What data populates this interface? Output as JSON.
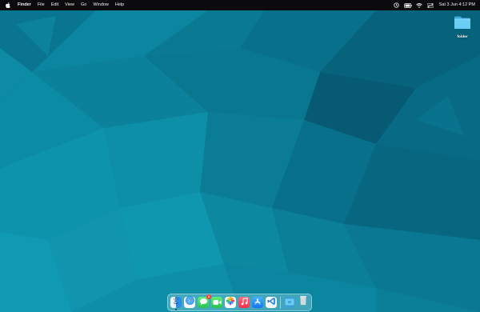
{
  "menubar": {
    "apple_icon": "apple-logo-icon",
    "app_name": "Finder",
    "menus": [
      "File",
      "Edit",
      "View",
      "Go",
      "Window",
      "Help"
    ],
    "status_icons": [
      "screen-mirroring-icon",
      "battery-icon",
      "wifi-icon",
      "control-center-icon"
    ],
    "clock": "Sat 3 Jun  4:12 PM"
  },
  "desktop": {
    "icon_label": "folder",
    "icon_name": "folder-icon"
  },
  "dock": {
    "apps": [
      {
        "icon": "finder-icon",
        "running": true
      },
      {
        "icon": "safari-icon"
      },
      {
        "icon": "messages-icon",
        "badge": "3"
      },
      {
        "icon": "facetime-icon"
      },
      {
        "icon": "photos-icon"
      },
      {
        "icon": "music-icon"
      },
      {
        "icon": "app-store-icon"
      },
      {
        "icon": "vscode-icon"
      }
    ],
    "folders": [
      "downloads-stack-icon",
      "trash-icon"
    ]
  },
  "colors": {
    "wallpaper_base": "#0b7f97",
    "menubar": "#0b0b0d",
    "folder": "#5ec3f0"
  }
}
